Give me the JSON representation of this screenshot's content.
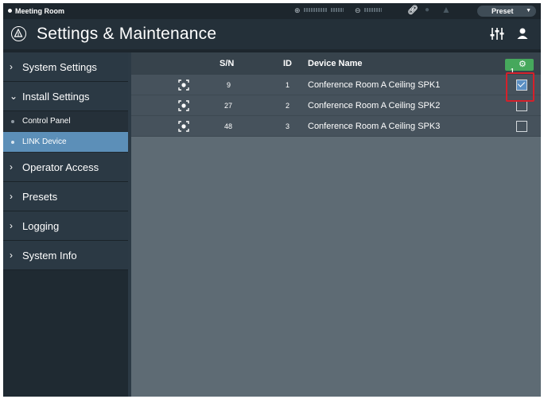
{
  "status_bar": {
    "room_name": "Meeting Room",
    "input_icon": "input-arrow-icon",
    "output_icon": "output-arrow-icon",
    "link_icon": "link-icon",
    "record_icon": "record-icon",
    "warning_icon": "warning-icon",
    "preset_label": "Preset"
  },
  "title_bar": {
    "title": "Settings & Maintenance",
    "logo_icon": "audio-technica-logo-icon",
    "mixer_icon": "mixer-sliders-icon",
    "user_icon": "user-icon"
  },
  "sidebar": {
    "items": [
      {
        "label": "System Settings",
        "expanded": false
      },
      {
        "label": "Install Settings",
        "expanded": true
      },
      {
        "label": "Operator Access",
        "expanded": false
      },
      {
        "label": "Presets",
        "expanded": false
      },
      {
        "label": "Logging",
        "expanded": false
      },
      {
        "label": "System Info",
        "expanded": false
      }
    ],
    "install_sub_items": [
      {
        "label": "Control Panel",
        "active": false
      },
      {
        "label": "LINK Device",
        "active": true
      }
    ]
  },
  "table": {
    "headers": {
      "sn": "S/N",
      "id": "ID",
      "name": "Device Name"
    },
    "badge_count": "1",
    "badge_icon": "gear-icon",
    "rows": [
      {
        "sn": "9",
        "id": "1",
        "name": "Conference Room A Ceiling SPK1",
        "checked": true
      },
      {
        "sn": "27",
        "id": "2",
        "name": "Conference Room A Ceiling SPK2",
        "checked": false
      },
      {
        "sn": "48",
        "id": "3",
        "name": "Conference Room A Ceiling SPK3",
        "checked": false
      }
    ]
  },
  "colors": {
    "active_sub_item": "#5c8fb8",
    "badge_green": "#46a85c",
    "highlight_red": "#d6202a",
    "checkbox_checked": "#5b8fc3"
  }
}
